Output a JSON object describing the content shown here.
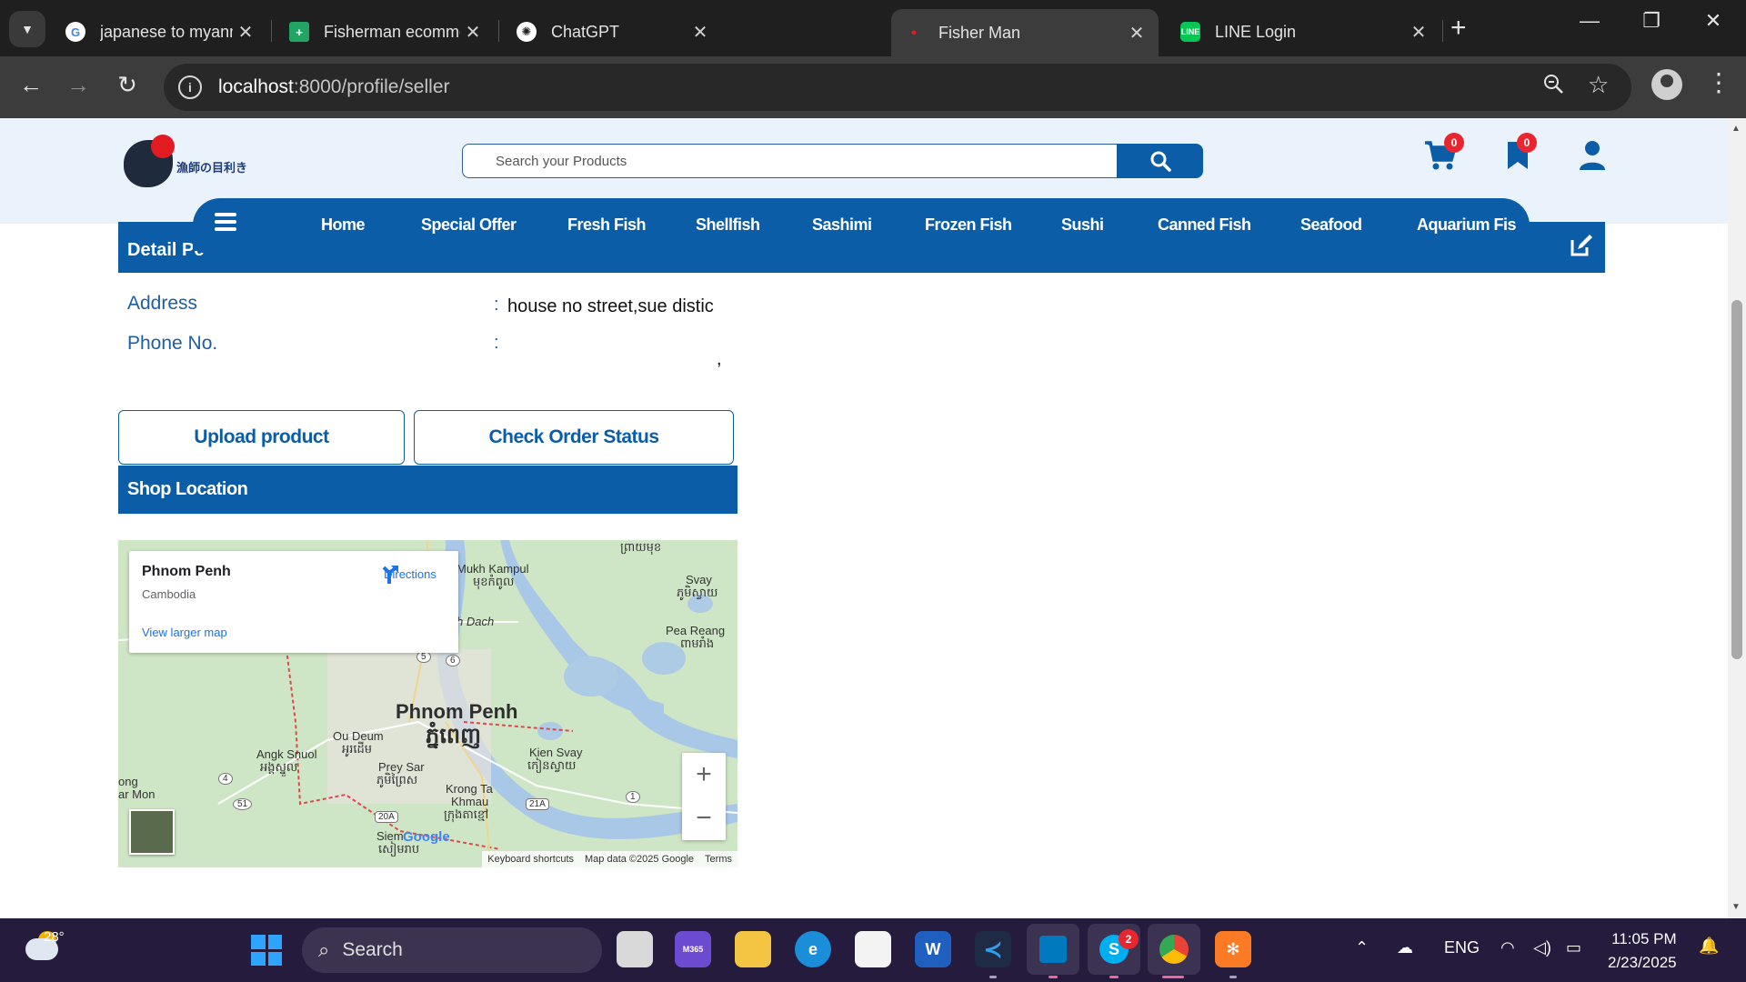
{
  "browser": {
    "tabs": [
      {
        "title": "japanese to myanmar - G",
        "favicon": "google-icon",
        "active": false
      },
      {
        "title": "Fisherman ecommerce w",
        "favicon": "sheets-icon",
        "active": false
      },
      {
        "title": "ChatGPT",
        "favicon": "chatgpt-icon",
        "active": false
      },
      {
        "title": "Fisher Man",
        "favicon": "fisherman-icon",
        "active": true
      },
      {
        "title": "LINE Login",
        "favicon": "line-icon",
        "active": false
      }
    ],
    "url_host": "localhost",
    "url_path": ":8000/profile/seller"
  },
  "site": {
    "logo_text": "漁師の目利き",
    "search_placeholder": "Search your Products",
    "cart_count": "0",
    "bookmark_count": "0",
    "nav": [
      "Home",
      "Special Offer",
      "Fresh Fish",
      "Shellfish",
      "Sashimi",
      "Frozen Fish",
      "Sushi",
      "Canned Fish",
      "Seafood",
      "Aquarium Fis"
    ]
  },
  "profile": {
    "detail_label": "Detail Pe",
    "address_label": "Address",
    "address_value": "house no street,sue distic",
    "phone_label": "Phone No.",
    "phone_value": "",
    "colon": ":",
    "comma": ",",
    "upload_button": "Upload product",
    "order_button": "Check Order Status",
    "shop_location_title": "Shop Location"
  },
  "map": {
    "place": "Phnom Penh",
    "country": "Cambodia",
    "directions": "Directions",
    "larger_map": "View larger map",
    "city_en": "Phnom Penh",
    "city_km": "ភ្នំពេញ",
    "labels": {
      "mukh_kampul": "Mukh Kampul",
      "mukh_kampul_km": "មុខកំពូល",
      "svay": "Svay",
      "svay_km": "ភូមិស្វាយ",
      "pea_reang": "Pea Reang",
      "pea_reang_km": "ពាមរាំង",
      "dach": "h Dach",
      "ou_deum": "Ou Deum",
      "ou_deum_km": "អូរដើម",
      "angk_snuol": "Angk Snuol",
      "angk_snuol_km": "អង្គស្នួល",
      "prey_sar": "Prey Sar",
      "prey_sar_km": "ភូមិព្រៃស",
      "kien_svay": "Kien Svay",
      "kien_svay_km": "កៀនស្វាយ",
      "krong_ta_khmau": "Krong Ta",
      "khmau": "Khmau",
      "khmau_km": "ក្រុងតាខ្មៅ",
      "siem": "Siem",
      "siem_km": "សៀមរាប",
      "long": "ong",
      "mon": "ar Mon",
      "top_km": "ព្រាយមុខ"
    },
    "road_4": "4",
    "road_5": "5",
    "road_6": "6",
    "road_51": "51",
    "road_1": "1",
    "road_20a": "20A",
    "road_21a": "21A",
    "keyboard": "Keyboard shortcuts",
    "map_data": "Map data ©2025 Google",
    "terms": "Terms",
    "google": "Google"
  },
  "taskbar": {
    "temperature": "28°",
    "search_label": "Search",
    "lang": "ENG",
    "time": "11:05 PM",
    "date": "2/23/2025",
    "skype_badge": "2",
    "m365_label": "M365"
  },
  "colors": {
    "brand_blue": "#0b5da8",
    "badge_red": "#e9252e",
    "header_bg": "#eaf2fb"
  }
}
